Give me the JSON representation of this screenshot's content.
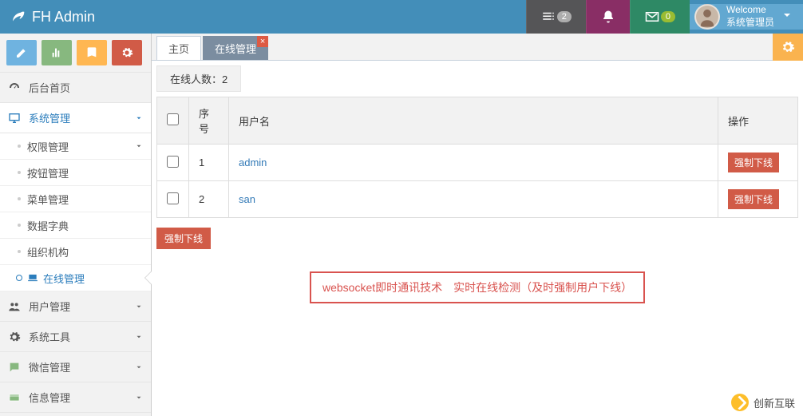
{
  "header": {
    "brand": "FH Admin",
    "msg_count": "2",
    "mail_count": "0",
    "welcome": "Welcome",
    "user_role": "系统管理员"
  },
  "sidebar": {
    "items": [
      {
        "icon": "dashboard",
        "label": "后台首页"
      },
      {
        "icon": "monitor",
        "label": "系统管理",
        "open": true,
        "children": [
          {
            "label": "权限管理",
            "has_chev": true
          },
          {
            "label": "按钮管理"
          },
          {
            "label": "菜单管理"
          },
          {
            "label": "数据字典"
          },
          {
            "label": "组织机构"
          },
          {
            "label": "在线管理",
            "active": true,
            "icon": "laptop"
          }
        ]
      },
      {
        "icon": "users",
        "label": "用户管理"
      },
      {
        "icon": "gear",
        "label": "系统工具"
      },
      {
        "icon": "chat",
        "label": "微信管理"
      },
      {
        "icon": "card",
        "label": "信息管理"
      }
    ]
  },
  "tabs": [
    {
      "label": "主页",
      "closable": false
    },
    {
      "label": "在线管理",
      "closable": true,
      "active": true
    }
  ],
  "content": {
    "online_label": "在线人数：",
    "online_count": "2",
    "columns": {
      "idx": "序号",
      "user": "用户名",
      "action": "操作"
    },
    "rows": [
      {
        "idx": "1",
        "user": "admin"
      },
      {
        "idx": "2",
        "user": "san"
      }
    ],
    "force_logout": "强制下线",
    "bulk_force_logout": "强制下线",
    "notice": "websocket即时通讯技术　实时在线检测（及时强制用户下线）"
  },
  "watermark": "创新互联"
}
